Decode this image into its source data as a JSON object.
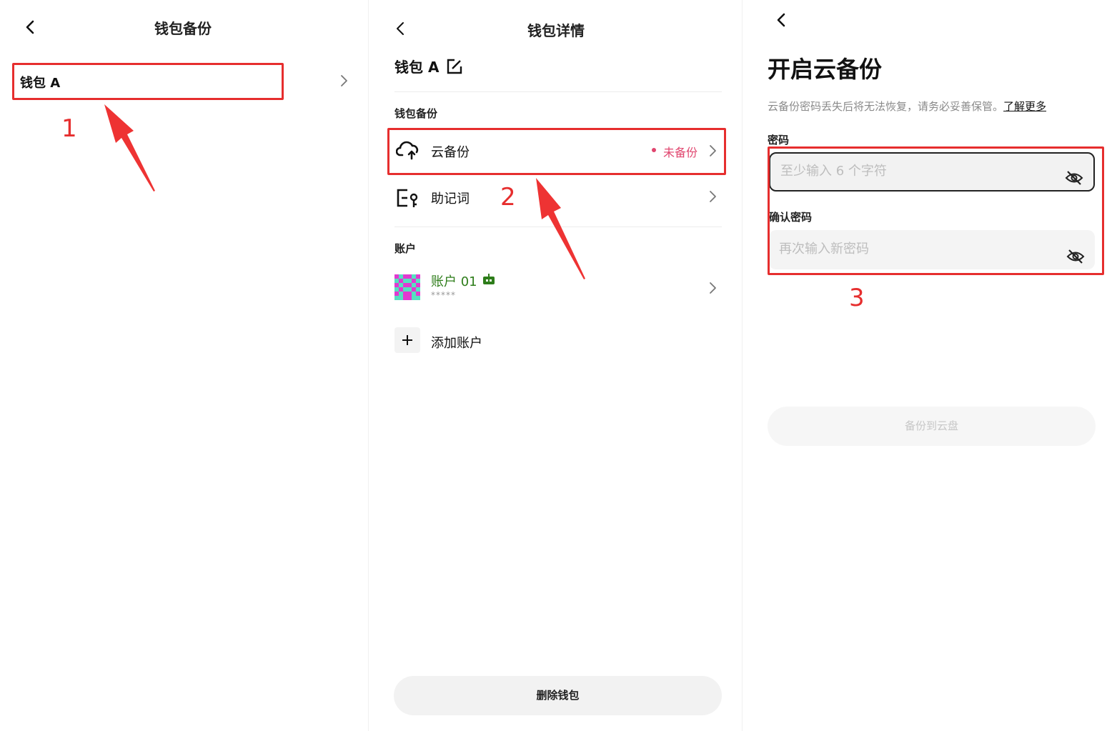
{
  "panel1": {
    "title": "钱包备份",
    "wallet_row": "钱包 A",
    "step_number": "1"
  },
  "panel2": {
    "title": "钱包详情",
    "wallet_name": "钱包 A",
    "section_backup": "钱包备份",
    "cloud_backup_label": "云备份",
    "cloud_backup_status": "未备份",
    "mnemonic_label": "助记词",
    "section_account": "账户",
    "account_name": "账户 01",
    "account_masked": "*****",
    "add_account_label": "添加账户",
    "delete_button": "删除钱包",
    "step_number": "2"
  },
  "panel3": {
    "title": "开启云备份",
    "description": "云备份密码丢失后将无法恢复，请务必妥善保管。",
    "learn_more": "了解更多",
    "password_label": "密码",
    "password_placeholder": "至少输入 6 个字符",
    "confirm_label": "确认密码",
    "confirm_placeholder": "再次输入新密码",
    "backup_button": "备份到云盘",
    "step_number": "3"
  },
  "icons": [
    "back-icon",
    "chevron-right-icon",
    "edit-icon",
    "cloud-upload-icon",
    "mnemonic-key-icon",
    "robot-icon",
    "plus-icon",
    "eye-off-icon"
  ],
  "colors": {
    "annotation_red": "#e62e2e",
    "status_pink": "#e0456e",
    "account_green": "#2e7d1a",
    "input_bg": "#f4f4f4",
    "button_bg": "#f2f2f2"
  }
}
